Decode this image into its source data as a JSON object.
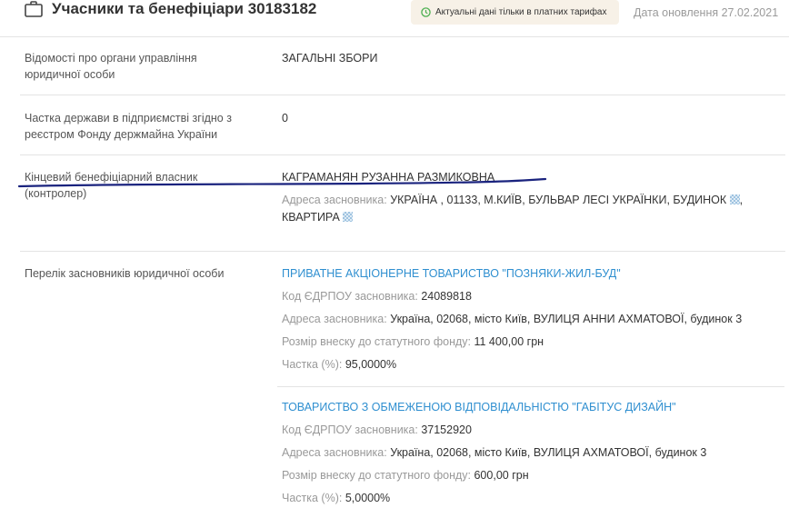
{
  "header": {
    "title": "Учасники та бенефіціари 30183182",
    "badge_text": "Актуальні дані тільки в платних тарифах",
    "updated_text": "Дата оновлення 27.02.2021"
  },
  "rows": {
    "governance": {
      "label_line1": "Відомості про органи управління",
      "label_line2": "юридичної особи",
      "value": "ЗАГАЛЬНІ ЗБОРИ"
    },
    "state_share": {
      "label_line1": "Частка держави в підприємстві згідно з",
      "label_line2": "реєстром Фонду держмайна України",
      "value": "0"
    },
    "beneficiary": {
      "label_line1": "Кінцевий бенефіціарний власник",
      "label_line2": "(контролер)",
      "name": "КАГРАМАНЯН РУЗАННА РАЗМИКОВНА",
      "address_label": "Адреса засновника:",
      "address_line1": "УКРАЇНА , 01133, М.КИЇВ, БУЛЬВАР ЛЕСІ УКРАЇНКИ, БУДИНОК",
      "address_line1_end": ",",
      "address_line2": "КВАРТИРА"
    },
    "founders": {
      "label": "Перелік засновників юридичної особи",
      "items": [
        {
          "name": "ПРИВАТНЕ АКЦІОНЕРНЕ ТОВАРИСТВО \"ПОЗНЯКИ-ЖИЛ-БУД\"",
          "code_label": "Код ЄДРПОУ засновника:",
          "code": "24089818",
          "address_label": "Адреса засновника:",
          "address": "Україна, 02068, місто Київ, ВУЛИЦЯ АННИ АХМАТОВОЇ, будинок 3",
          "contribution_label": "Розмір внеску до статутного фонду:",
          "contribution": "11 400,00 грн",
          "share_label": "Частка (%):",
          "share": "95,0000%"
        },
        {
          "name": "ТОВАРИСТВО З ОБМЕЖЕНОЮ ВІДПОВІДАЛЬНІСТЮ \"ГАБІТУС ДИЗАЙН\"",
          "code_label": "Код ЄДРПОУ засновника:",
          "code": "37152920",
          "address_label": "Адреса засновника:",
          "address": "Україна, 02068, місто Київ, ВУЛИЦЯ АХМАТОВОЇ, будинок 3",
          "contribution_label": "Розмір внеску до статутного фонду:",
          "contribution": "600,00 грн",
          "share_label": "Частка (%):",
          "share": "5,0000%"
        }
      ]
    }
  },
  "colors": {
    "link": "#2f8fd0",
    "badge_bg": "#f7f1e7",
    "badge_icon": "#4caf50",
    "annotation_line": "#1a237e"
  },
  "icons": {
    "title_icon": "briefcase-icon",
    "badge_icon": "clock-icon",
    "masked": "mosaic-redaction"
  }
}
